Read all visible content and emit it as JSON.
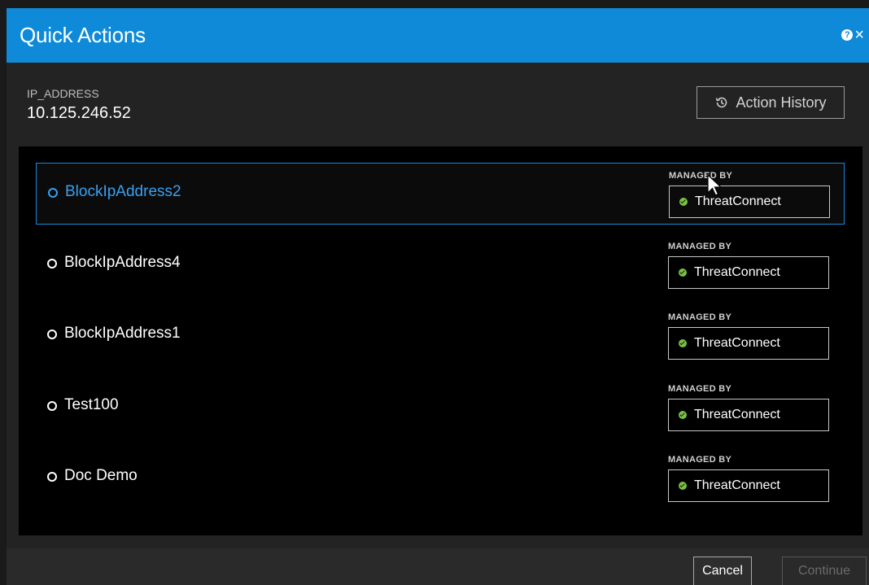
{
  "dialog": {
    "title": "Quick Actions",
    "help_icon": "help-circle-icon",
    "close_icon": "close-icon"
  },
  "target": {
    "label": "IP_ADDRESS",
    "value": "10.125.246.52"
  },
  "history_button": {
    "label": "Action History",
    "icon": "history-icon"
  },
  "actions": [
    {
      "name": "BlockIpAddress2",
      "managed_by_label": "MANAGED BY",
      "managed_by": "ThreatConnect",
      "selected": true
    },
    {
      "name": "BlockIpAddress4",
      "managed_by_label": "MANAGED BY",
      "managed_by": "ThreatConnect",
      "selected": false
    },
    {
      "name": "BlockIpAddress1",
      "managed_by_label": "MANAGED BY",
      "managed_by": "ThreatConnect",
      "selected": false
    },
    {
      "name": "Test100",
      "managed_by_label": "MANAGED BY",
      "managed_by": "ThreatConnect",
      "selected": false
    },
    {
      "name": "Doc Demo",
      "managed_by_label": "MANAGED BY",
      "managed_by": "ThreatConnect",
      "selected": false
    }
  ],
  "footer": {
    "cancel_label": "Cancel",
    "continue_label": "Continue"
  },
  "colors": {
    "accent": "#0e8ad8",
    "selected": "#3aa0f0",
    "status_ok": "#7ac142"
  }
}
